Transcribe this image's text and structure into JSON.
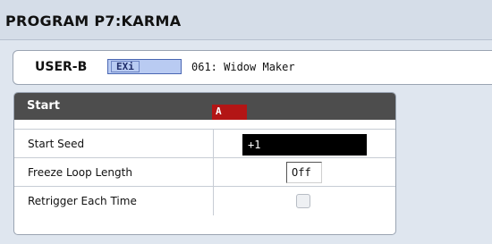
{
  "title": "PROGRAM P7:KARMA",
  "program": {
    "bank": "USER-B",
    "engine_badge": "EXi",
    "name": "061: Widow Maker"
  },
  "panel": {
    "title": "Start",
    "marker": "A",
    "rows": [
      {
        "label": "Start Seed",
        "value": "+1"
      },
      {
        "label": "Freeze Loop Length",
        "value": "Off"
      },
      {
        "label": "Retrigger Each Time",
        "checked": false
      }
    ]
  },
  "colors": {
    "background": "#dfe6ef",
    "header": "#4d4d4d",
    "marker": "#b31515",
    "badge": "#b9cbf2"
  }
}
